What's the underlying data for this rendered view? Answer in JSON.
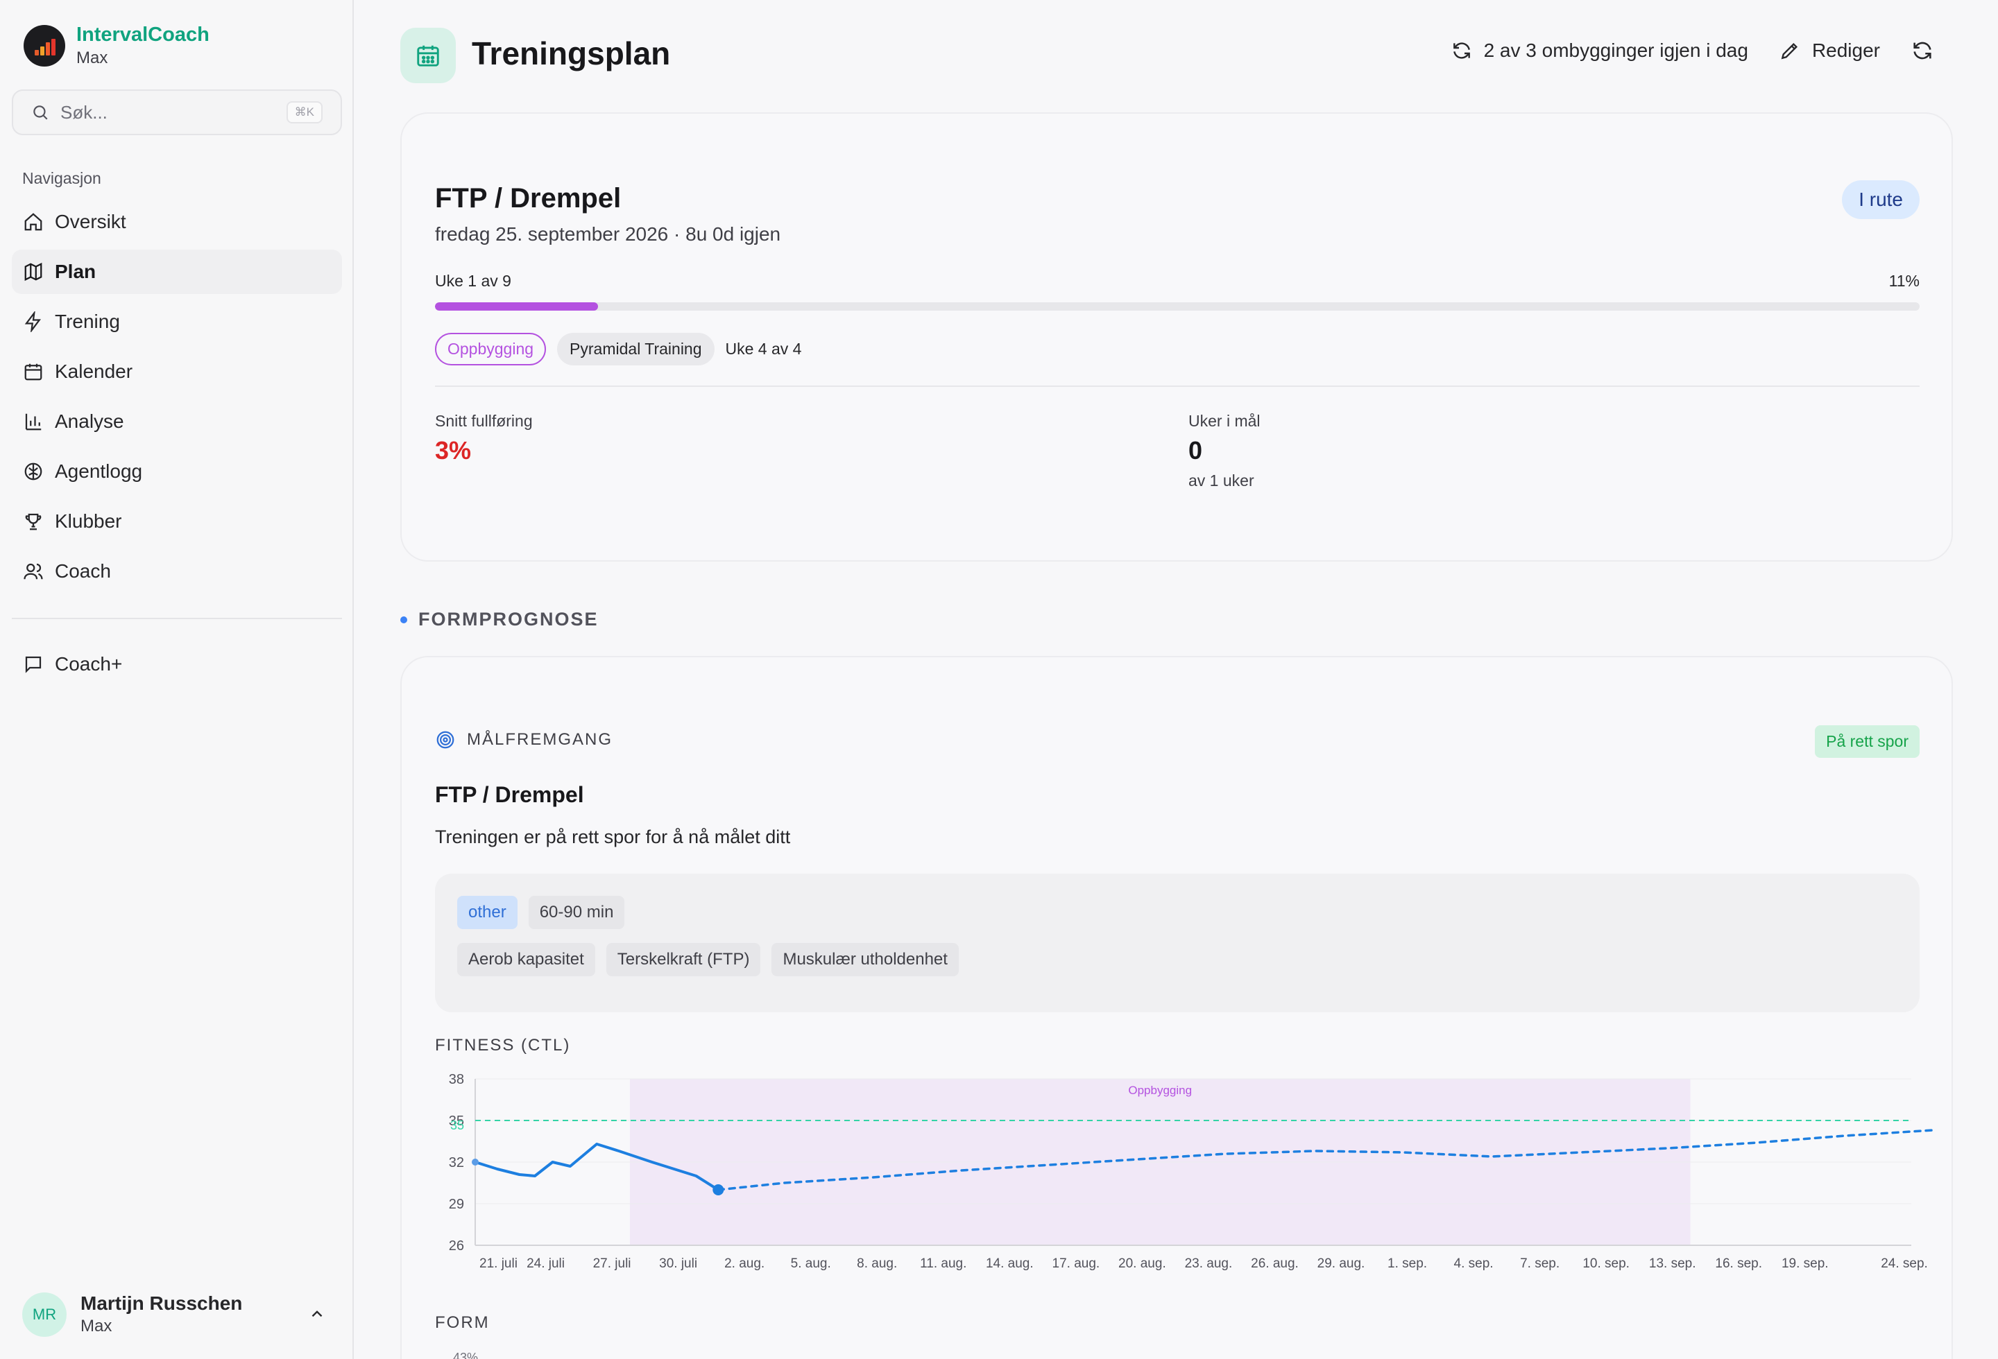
{
  "brand": {
    "name": "IntervalCoach",
    "plan": "Max"
  },
  "search": {
    "placeholder": "Søk...",
    "shortcut": "⌘K"
  },
  "sidebar": {
    "heading": "Navigasjon",
    "items": [
      {
        "label": "Oversikt",
        "icon": "home-icon"
      },
      {
        "label": "Plan",
        "icon": "map-icon",
        "active": true
      },
      {
        "label": "Trening",
        "icon": "bolt-icon"
      },
      {
        "label": "Kalender",
        "icon": "calendar-icon"
      },
      {
        "label": "Analyse",
        "icon": "bar-chart-icon"
      },
      {
        "label": "Agentlogg",
        "icon": "brain-icon"
      },
      {
        "label": "Klubber",
        "icon": "trophy-icon"
      },
      {
        "label": "Coach",
        "icon": "users-icon"
      }
    ],
    "extra": {
      "label": "Coach+",
      "icon": "message-icon"
    }
  },
  "user": {
    "initials": "MR",
    "name": "Martijn Russchen",
    "plan": "Max"
  },
  "header": {
    "title": "Treningsplan",
    "rebuilds": "2 av 3 ombygginger igjen i dag",
    "edit": "Rediger"
  },
  "goal": {
    "title": "FTP / Drempel",
    "date": "fredag 25. september 2026 · 8u 0d igjen",
    "status": "I rute",
    "week": "Uke 1 av 9",
    "pct": "11%",
    "progress": 0.11,
    "phase": "Oppbygging",
    "block": "Pyramidal Training",
    "block_week": "Uke 4 av 4",
    "stats": {
      "completion_label": "Snitt fullføring",
      "completion_value": "3%",
      "weeks_label": "Uker i mål",
      "weeks_value": "0",
      "weeks_sub": "av 1 uker"
    }
  },
  "forecast": {
    "section": "FORMPROGNOSE",
    "head": "MÅLFREMGANG",
    "status": "På rett spor",
    "title": "FTP / Drempel",
    "desc": "Treningen er på rett spor for å nå målet ditt",
    "chips_row1": [
      "other",
      "60-90 min"
    ],
    "chips_row2": [
      "Aerob kapasitet",
      "Terskelkraft (FTP)",
      "Muskulær utholdenhet"
    ],
    "chart_title": "FITNESS (CTL)",
    "form_title": "FORM",
    "form_tick": "43%"
  },
  "chart_data": {
    "type": "line",
    "title": "FITNESS (CTL)",
    "x_ticks": [
      "21. juli",
      "24. juli",
      "27. juli",
      "30. juli",
      "2. aug.",
      "5. aug.",
      "8. aug.",
      "11. aug.",
      "14. aug.",
      "17. aug.",
      "20. aug.",
      "23. aug.",
      "26. aug.",
      "29. aug.",
      "1. sep.",
      "4. sep.",
      "7. sep.",
      "10. sep.",
      "13. sep.",
      "16. sep.",
      "19. sep.",
      "24. sep."
    ],
    "y_ticks": [
      38,
      35,
      32,
      29,
      26
    ],
    "ylim": [
      26,
      38
    ],
    "target": {
      "value": 35,
      "label": "35"
    },
    "band": {
      "label": "Oppbygging",
      "from_day": 7,
      "to_day": 55
    },
    "series": [
      {
        "style": "solid",
        "points": [
          [
            0,
            32
          ],
          [
            1,
            31.5
          ],
          [
            2,
            31.1
          ],
          [
            2.7,
            31
          ],
          [
            3.5,
            32
          ],
          [
            4.3,
            31.7
          ],
          [
            5.5,
            33.3
          ],
          [
            6.5,
            32.8
          ],
          [
            8,
            32
          ],
          [
            10,
            31
          ],
          [
            11,
            30
          ]
        ]
      },
      {
        "style": "dashed",
        "points": [
          [
            11,
            30
          ],
          [
            14,
            30.5
          ],
          [
            18,
            30.9
          ],
          [
            22,
            31.4
          ],
          [
            26,
            31.8
          ],
          [
            30,
            32.2
          ],
          [
            34,
            32.6
          ],
          [
            38,
            32.8
          ],
          [
            42,
            32.7
          ],
          [
            46,
            32.4
          ],
          [
            50,
            32.7
          ],
          [
            54,
            33
          ],
          [
            58,
            33.4
          ],
          [
            62,
            33.9
          ],
          [
            66,
            34.3
          ],
          [
            70,
            34.8
          ]
        ]
      }
    ],
    "colors": {
      "line": "#1d7fe0",
      "target": "#34d3a6",
      "band": "#f1e8f7",
      "band_label": "#b452e0",
      "end_dot": "#10d39e"
    }
  }
}
